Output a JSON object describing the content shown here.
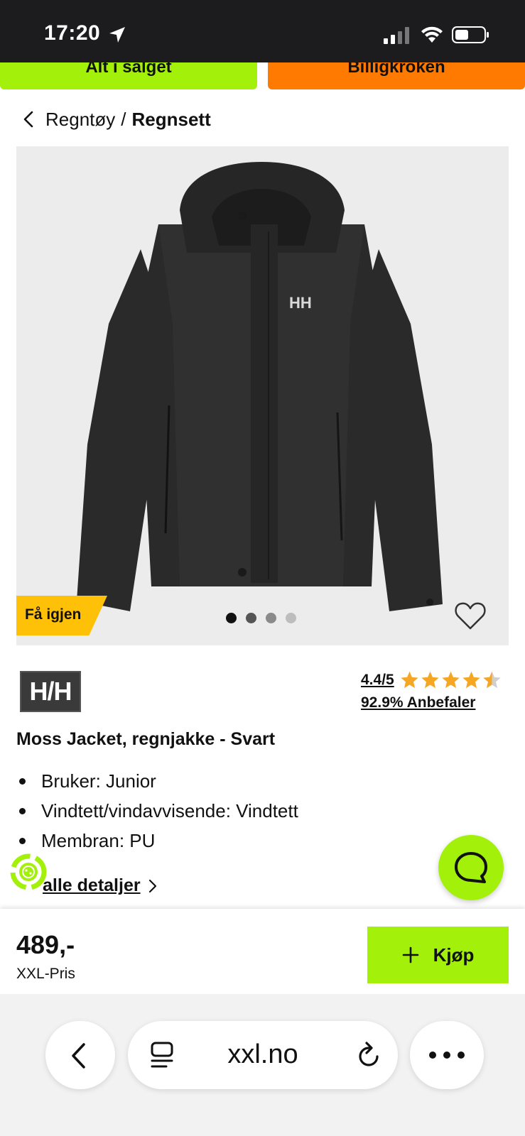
{
  "status_bar": {
    "time": "17:20"
  },
  "promos": {
    "left_label": "Alt i salget",
    "right_label": "Billigkroken"
  },
  "breadcrumb": {
    "parent": "Regntøy",
    "separator": "/",
    "current": "Regnsett"
  },
  "gallery": {
    "badge": "Få igjen",
    "logo_on_jacket": "HH",
    "slides_total": 4,
    "active_slide": 1
  },
  "brand": {
    "logo_text": "H/H"
  },
  "rating": {
    "score": "4.4/5",
    "stars_value": 4.4,
    "stars_max": 5,
    "recommend": "92.9% Anbefaler"
  },
  "product": {
    "title": "Moss Jacket, regnjakke - Svart",
    "features": [
      "Bruker: Junior",
      "Vindtett/vindavvisende: Vindtett",
      "Membran: PU"
    ],
    "details_link": "alle detaljer"
  },
  "purchase": {
    "price": "489,-",
    "price_label": "XXL-Pris",
    "buy_label": "Kjøp"
  },
  "browser": {
    "url": "xxl.no"
  },
  "colors": {
    "accent": "#a3f10b",
    "orange": "#ff7a00",
    "badge": "#ffc107",
    "star": "#f5a623"
  }
}
